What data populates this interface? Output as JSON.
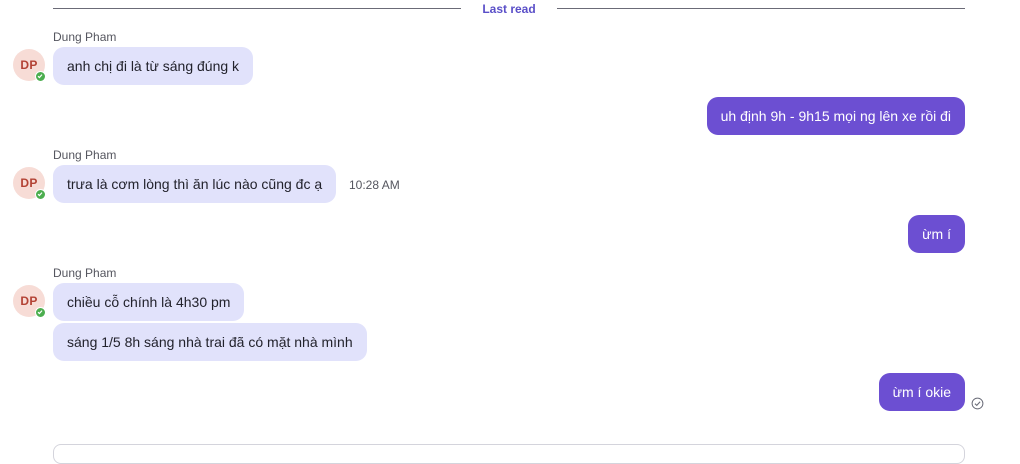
{
  "divider": {
    "label": "Last read"
  },
  "groups": [
    {
      "sender": "Dung Pham",
      "avatar": "DP",
      "messages": [
        "anh chị đi là từ sáng đúng k"
      ]
    },
    {
      "sender": "Dung Pham",
      "avatar": "DP",
      "messages": [
        "trưa là cơm lòng thì ăn lúc nào cũng đc ạ"
      ],
      "time": "10:28 AM"
    },
    {
      "sender": "Dung Pham",
      "avatar": "DP",
      "messages": [
        "chiều cỗ chính là 4h30 pm",
        "sáng 1/5 8h sáng nhà trai đã có mặt nhà mình"
      ]
    }
  ],
  "outgoing": [
    "uh định 9h - 9h15 mọi ng lên xe rồi đi",
    "ừm í",
    "ừm í okie"
  ],
  "icons": {
    "presence": "check-icon",
    "read_receipt": "read-check-icon"
  },
  "colors": {
    "incoming_bubble": "#e1e2fb",
    "outgoing_bubble": "#6c4fd2",
    "divider_label": "#5a4fc8",
    "avatar_bg": "#f7dcd6",
    "presence": "#4cae4f"
  }
}
